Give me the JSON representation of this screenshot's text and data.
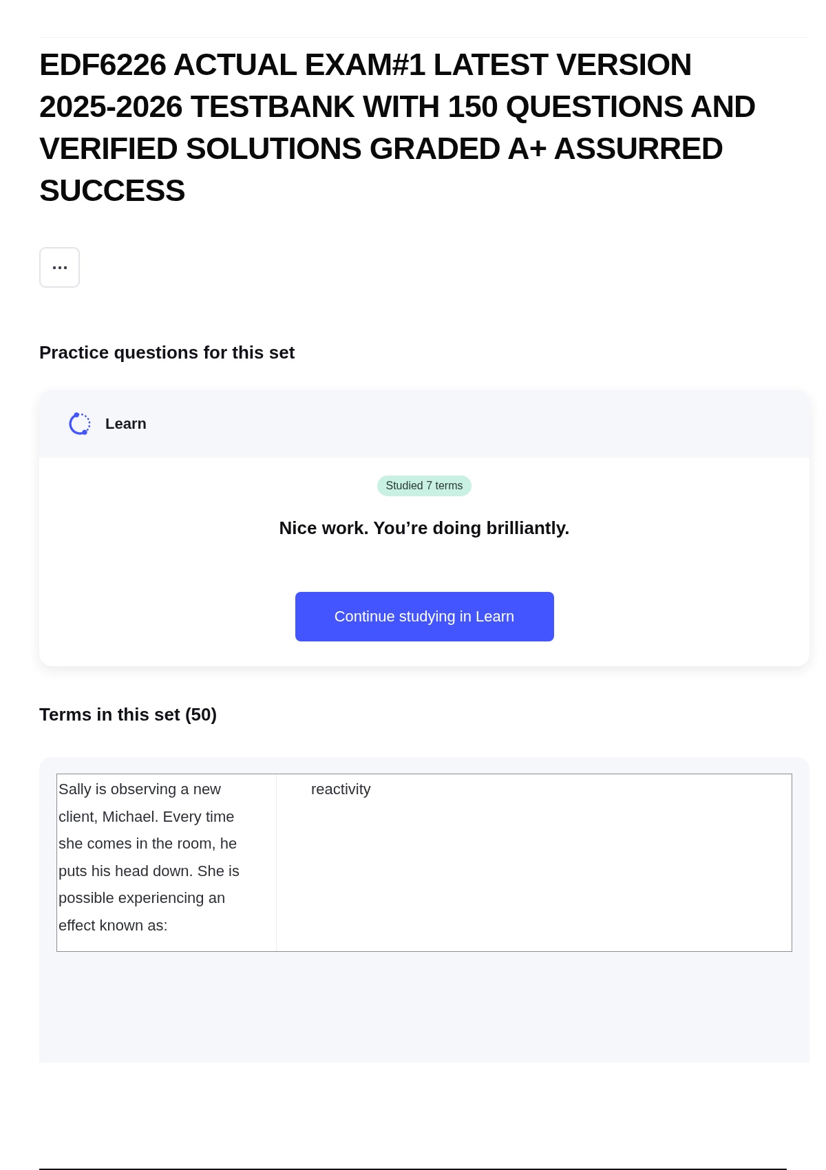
{
  "title": "EDF6226 ACTUAL EXAM#1 LATEST VERSION 2025-2026 TESTBANK WITH 150 QUESTIONS AND VERIFIED SOLUTIONS GRADED A+ ASSURRED SUCCESS",
  "practice": {
    "heading": "Practice questions for this set",
    "card": {
      "mode": "Learn",
      "badge": "Studied 7 terms",
      "message": "Nice work. You’re doing brilliantly.",
      "button": "Continue studying in Learn"
    }
  },
  "terms": {
    "heading": "Terms in this set (50)",
    "rows": [
      {
        "term": "Sally is observing a new client, Michael. Every time she comes in the room, he puts his head down. She is possible experiencing an effect known as:",
        "definition": "reactivity"
      }
    ]
  }
}
